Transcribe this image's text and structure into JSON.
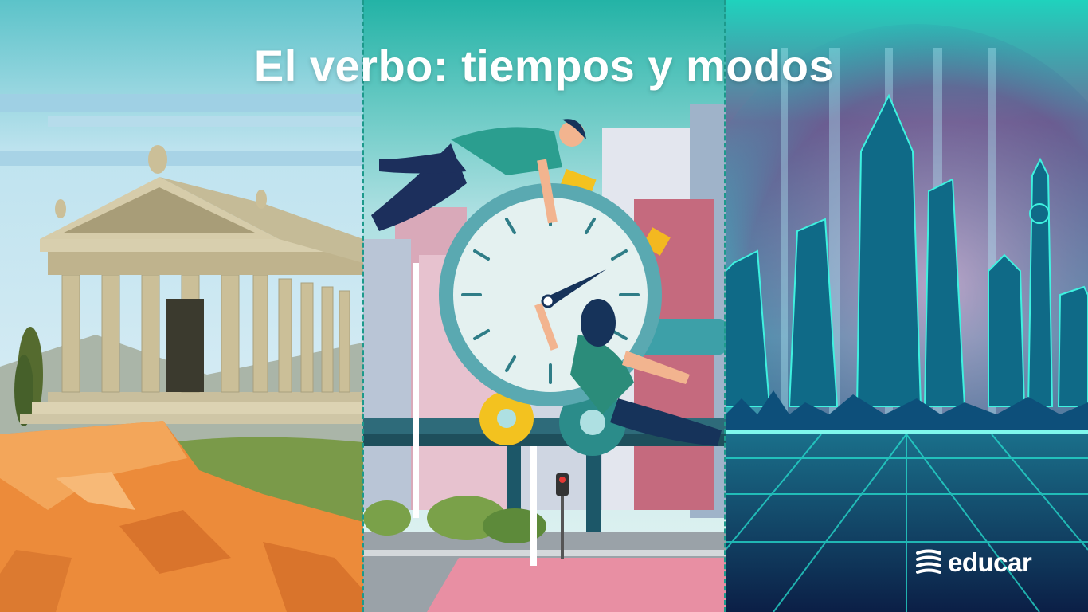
{
  "title": "El verbo: tiempos y modos",
  "brand": {
    "name": "educar",
    "icon": "educar-logo-icon"
  },
  "panels": [
    {
      "name": "past",
      "illustration": "ancient-greek-temple"
    },
    {
      "name": "present",
      "illustration": "stopwatch-with-people-in-city"
    },
    {
      "name": "future",
      "illustration": "futuristic-neon-city"
    }
  ],
  "colors": {
    "divider": "#1d9a8c",
    "title": "#ffffff",
    "sky_past": "#dcebf5",
    "sky_present": "#2fb7a7",
    "neon_future": "#17e5d2"
  }
}
